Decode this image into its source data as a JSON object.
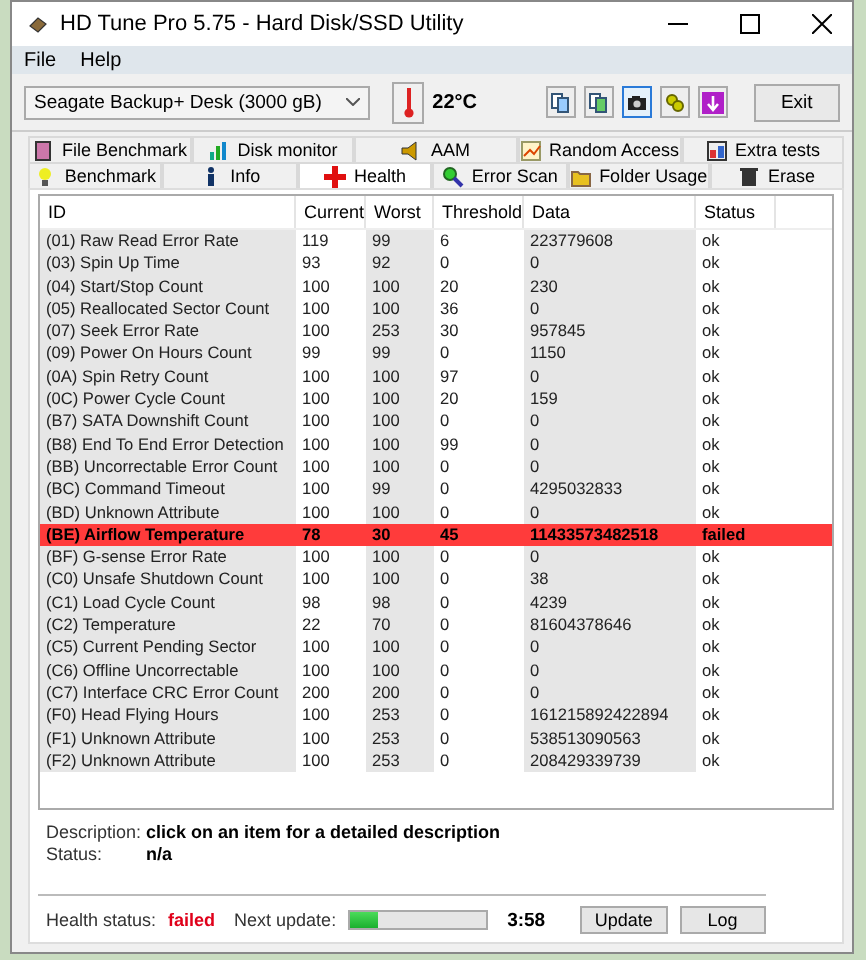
{
  "window": {
    "title": "HD Tune Pro 5.75 - Hard Disk/SSD Utility"
  },
  "menu": [
    "File",
    "Help"
  ],
  "toolbar": {
    "drive": "Seagate Backup+ Desk (3000 gB)",
    "temperature": "22°C",
    "tools": [
      {
        "kind": "copy",
        "selected": false
      },
      {
        "kind": "copy2",
        "selected": false
      },
      {
        "kind": "camera",
        "selected": true
      },
      {
        "kind": "options",
        "selected": false
      },
      {
        "kind": "save",
        "selected": false
      }
    ],
    "exit": "Exit"
  },
  "tabs_top": [
    {
      "label": "File Benchmark",
      "selected": false
    },
    {
      "label": "Disk monitor",
      "selected": false
    },
    {
      "label": "AAM",
      "selected": false
    },
    {
      "label": "Random Access",
      "selected": false
    },
    {
      "label": "Extra tests",
      "selected": false
    }
  ],
  "tabs_bottom": [
    {
      "label": "Benchmark",
      "selected": false
    },
    {
      "label": "Info",
      "selected": false
    },
    {
      "label": "Health",
      "selected": true
    },
    {
      "label": "Error Scan",
      "selected": false
    },
    {
      "label": "Folder Usage",
      "selected": false
    },
    {
      "label": "Erase",
      "selected": false
    }
  ],
  "table": {
    "columns": [
      "ID",
      "Current",
      "Worst",
      "Threshold",
      "Data",
      "Status"
    ],
    "rows": [
      {
        "cells": [
          "(01) Raw Read Error Rate",
          "119",
          "99",
          "6",
          "223779608",
          "ok"
        ],
        "failed": false
      },
      {
        "cells": [
          "(03) Spin Up Time",
          "93",
          "92",
          "0",
          "0",
          "ok"
        ],
        "failed": false
      },
      {
        "cells": [
          "(04) Start/Stop Count",
          "100",
          "100",
          "20",
          "230",
          "ok"
        ],
        "failed": false
      },
      {
        "cells": [
          "(05) Reallocated Sector Count",
          "100",
          "100",
          "36",
          "0",
          "ok"
        ],
        "failed": false
      },
      {
        "cells": [
          "(07) Seek Error Rate",
          "100",
          "253",
          "30",
          "957845",
          "ok"
        ],
        "failed": false
      },
      {
        "cells": [
          "(09) Power On Hours Count",
          "99",
          "99",
          "0",
          "1150",
          "ok"
        ],
        "failed": false
      },
      {
        "cells": [
          "(0A) Spin Retry Count",
          "100",
          "100",
          "97",
          "0",
          "ok"
        ],
        "failed": false
      },
      {
        "cells": [
          "(0C) Power Cycle Count",
          "100",
          "100",
          "20",
          "159",
          "ok"
        ],
        "failed": false
      },
      {
        "cells": [
          "(B7) SATA Downshift Count",
          "100",
          "100",
          "0",
          "0",
          "ok"
        ],
        "failed": false
      },
      {
        "cells": [
          "(B8) End To End Error Detection",
          "100",
          "100",
          "99",
          "0",
          "ok"
        ],
        "failed": false
      },
      {
        "cells": [
          "(BB) Uncorrectable Error Count",
          "100",
          "100",
          "0",
          "0",
          "ok"
        ],
        "failed": false
      },
      {
        "cells": [
          "(BC) Command Timeout",
          "100",
          "99",
          "0",
          "4295032833",
          "ok"
        ],
        "failed": false
      },
      {
        "cells": [
          "(BD) Unknown Attribute",
          "100",
          "100",
          "0",
          "0",
          "ok"
        ],
        "failed": false
      },
      {
        "cells": [
          "(BE) Airflow Temperature",
          "78",
          "30",
          "45",
          "11433573482518",
          "failed"
        ],
        "failed": true
      },
      {
        "cells": [
          "(BF) G-sense Error Rate",
          "100",
          "100",
          "0",
          "0",
          "ok"
        ],
        "failed": false
      },
      {
        "cells": [
          "(C0) Unsafe Shutdown Count",
          "100",
          "100",
          "0",
          "38",
          "ok"
        ],
        "failed": false
      },
      {
        "cells": [
          "(C1) Load Cycle Count",
          "98",
          "98",
          "0",
          "4239",
          "ok"
        ],
        "failed": false
      },
      {
        "cells": [
          "(C2) Temperature",
          "22",
          "70",
          "0",
          "81604378646",
          "ok"
        ],
        "failed": false
      },
      {
        "cells": [
          "(C5) Current Pending Sector",
          "100",
          "100",
          "0",
          "0",
          "ok"
        ],
        "failed": false
      },
      {
        "cells": [
          "(C6) Offline Uncorrectable",
          "100",
          "100",
          "0",
          "0",
          "ok"
        ],
        "failed": false
      },
      {
        "cells": [
          "(C7) Interface CRC Error Count",
          "200",
          "200",
          "0",
          "0",
          "ok"
        ],
        "failed": false
      },
      {
        "cells": [
          "(F0) Head Flying Hours",
          "100",
          "253",
          "0",
          "161215892422894",
          "ok"
        ],
        "failed": false
      },
      {
        "cells": [
          "(F1) Unknown Attribute",
          "100",
          "253",
          "0",
          "538513090563",
          "ok"
        ],
        "failed": false
      },
      {
        "cells": [
          "(F2) Unknown Attribute",
          "100",
          "253",
          "0",
          "208429339739",
          "ok"
        ],
        "failed": false
      }
    ]
  },
  "details": [
    {
      "label": "Description:",
      "value": "click on an item for a detailed description"
    },
    {
      "label": "Status:",
      "value": "n/a"
    }
  ],
  "footer": {
    "health_label": "Health status:",
    "health_value": "failed",
    "update_label": "Next update:",
    "level": 0.2,
    "countdown": "3:58",
    "buttons": [
      "Update",
      "Log"
    ]
  }
}
